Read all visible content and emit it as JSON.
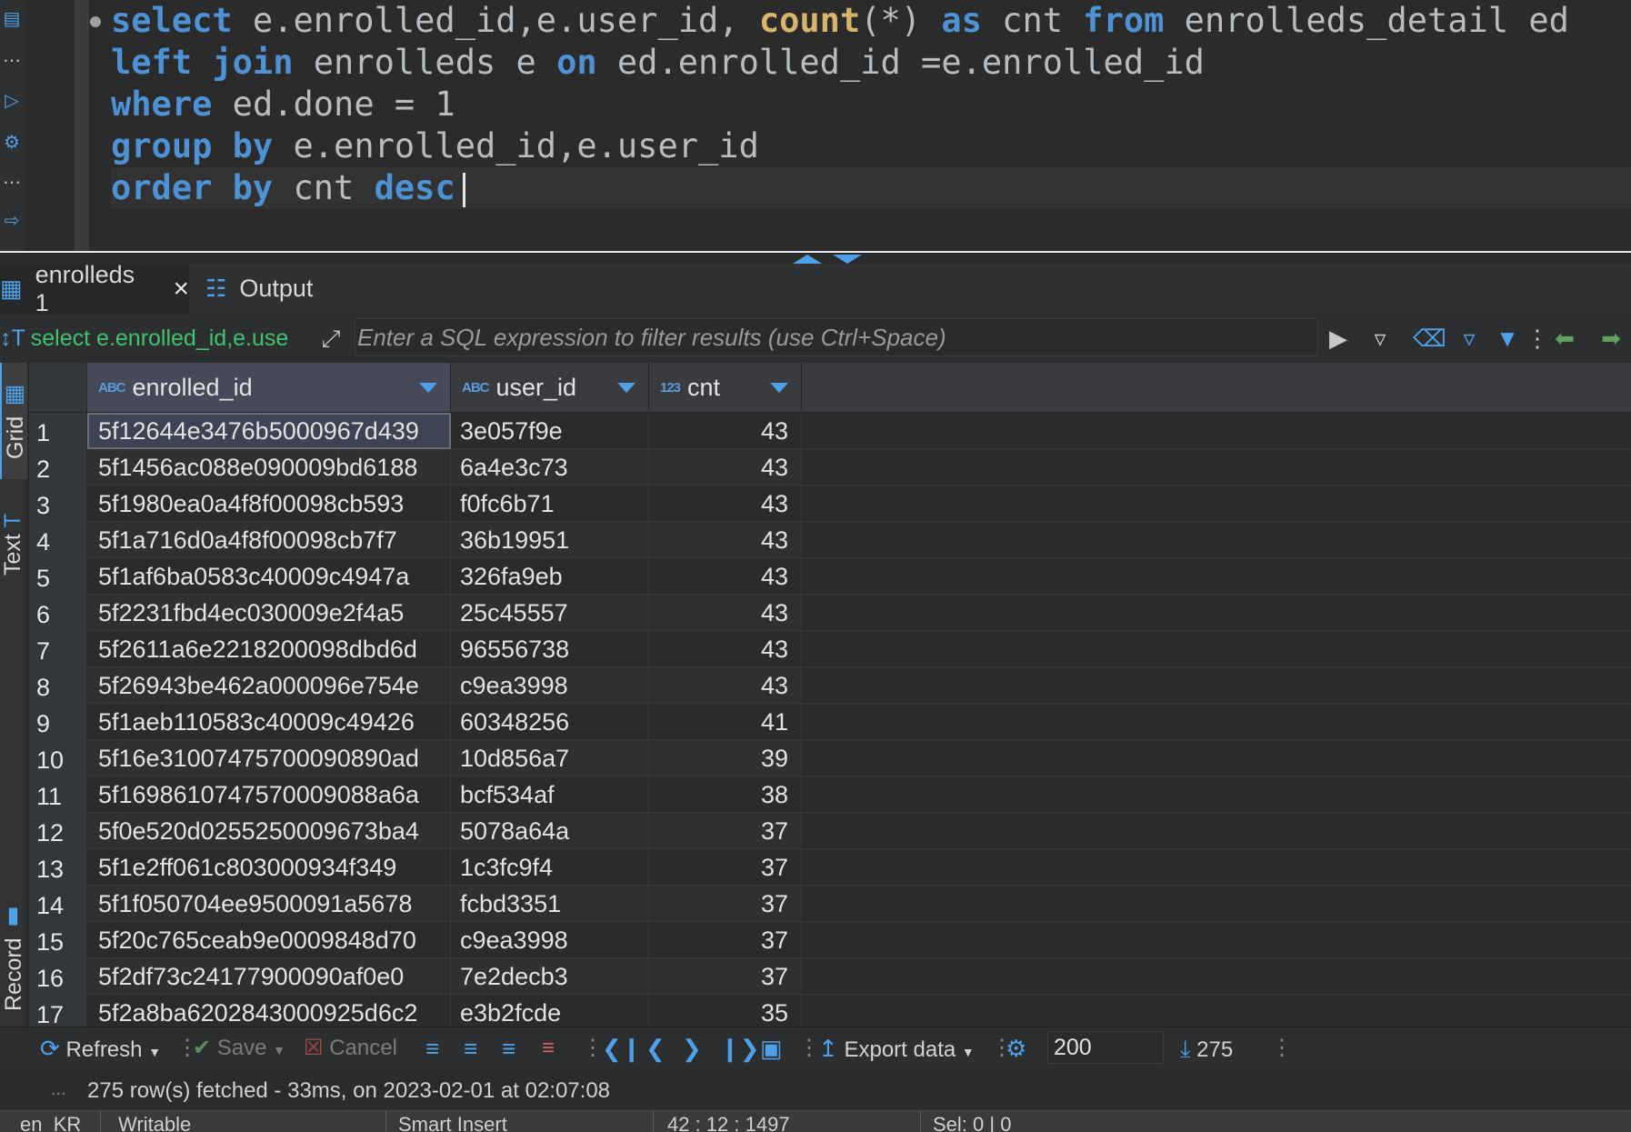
{
  "editor": {
    "lines": [
      [
        {
          "t": "select",
          "c": "kw"
        },
        {
          "t": " e.enrolled_id,e.user_id, "
        },
        {
          "t": "count",
          "c": "fn"
        },
        {
          "t": "(*) "
        },
        {
          "t": "as",
          "c": "kw"
        },
        {
          "t": " cnt "
        },
        {
          "t": "from",
          "c": "kw"
        },
        {
          "t": " enrolleds_detail ed"
        }
      ],
      [
        {
          "t": "left join",
          "c": "kw"
        },
        {
          "t": " enrolleds e "
        },
        {
          "t": "on",
          "c": "kw"
        },
        {
          "t": " ed.enrolled_id =e.enrolled_id"
        }
      ],
      [
        {
          "t": "where",
          "c": "kw"
        },
        {
          "t": " ed.done = 1"
        }
      ],
      [
        {
          "t": "group by",
          "c": "kw"
        },
        {
          "t": " e.enrolled_id,e.user_id"
        }
      ],
      [
        {
          "t": "order by",
          "c": "kw"
        },
        {
          "t": " cnt "
        },
        {
          "t": "desc",
          "c": "kw"
        }
      ]
    ]
  },
  "tabs": [
    {
      "label": "enrolleds 1",
      "icon": "table-icon",
      "closable": true,
      "active": true
    },
    {
      "label": "Output",
      "icon": "output-icon",
      "closable": false,
      "active": false
    }
  ],
  "filter": {
    "query_label": "select e.enrolled_id,e.use",
    "placeholder": "Enter a SQL expression to filter results (use Ctrl+Space)"
  },
  "side_tabs": {
    "grid": "Grid",
    "text": "Text",
    "record": "Record"
  },
  "grid": {
    "columns": [
      {
        "name": "enrolled_id",
        "type": "ABC"
      },
      {
        "name": "user_id",
        "type": "ABC"
      },
      {
        "name": "cnt",
        "type": "123"
      }
    ],
    "rows": [
      [
        "1",
        "5f12644e3476b5000967d439",
        "3e057f9e",
        "43"
      ],
      [
        "2",
        "5f1456ac088e090009bd6188",
        "6a4e3c73",
        "43"
      ],
      [
        "3",
        "5f1980ea0a4f8f00098cb593",
        "f0fc6b71",
        "43"
      ],
      [
        "4",
        "5f1a716d0a4f8f00098cb7f7",
        "36b19951",
        "43"
      ],
      [
        "5",
        "5f1af6ba0583c40009c4947a",
        "326fa9eb",
        "43"
      ],
      [
        "6",
        "5f2231fbd4ec030009e2f4a5",
        "25c45557",
        "43"
      ],
      [
        "7",
        "5f2611a6e2218200098dbd6d",
        "96556738",
        "43"
      ],
      [
        "8",
        "5f26943be462a000096e754e",
        "c9ea3998",
        "43"
      ],
      [
        "9",
        "5f1aeb110583c40009c49426",
        "60348256",
        "41"
      ],
      [
        "10",
        "5f16e31007475700090890ad",
        "10d856a7",
        "39"
      ],
      [
        "11",
        "5f1698610747570009088a6a",
        "bcf534af",
        "38"
      ],
      [
        "12",
        "5f0e520d0255250009673ba4",
        "5078a64a",
        "37"
      ],
      [
        "13",
        "5f1e2ff061c803000934f349",
        "1c3fc9f4",
        "37"
      ],
      [
        "14",
        "5f1f050704ee9500091a5678",
        "fcbd3351",
        "37"
      ],
      [
        "15",
        "5f20c765ceab9e0009848d70",
        "c9ea3998",
        "37"
      ],
      [
        "16",
        "5f2df73c24177900090af0e0",
        "7e2decb3",
        "37"
      ],
      [
        "17",
        "5f2a8ba6202843000925d6c2",
        "e3b2fcde",
        "35"
      ]
    ]
  },
  "toolbar": {
    "refresh": "Refresh",
    "save": "Save",
    "cancel": "Cancel",
    "export": "Export data",
    "max_rows": "200",
    "row_count": "275"
  },
  "status": {
    "dots": "...",
    "text": "275 row(s) fetched - 33ms, on 2023-02-01 at 02:07:08"
  },
  "footer": {
    "encoding": "en_KR",
    "mode": "Writable",
    "insert": "Smart Insert",
    "position": "42 : 12 : 1497",
    "selection": "Sel: 0 | 0"
  },
  "colors": {
    "keyword": "#4e92d6",
    "function": "#d8b56a",
    "accent": "#4ea1e8",
    "filter_query": "#3ec46d"
  }
}
